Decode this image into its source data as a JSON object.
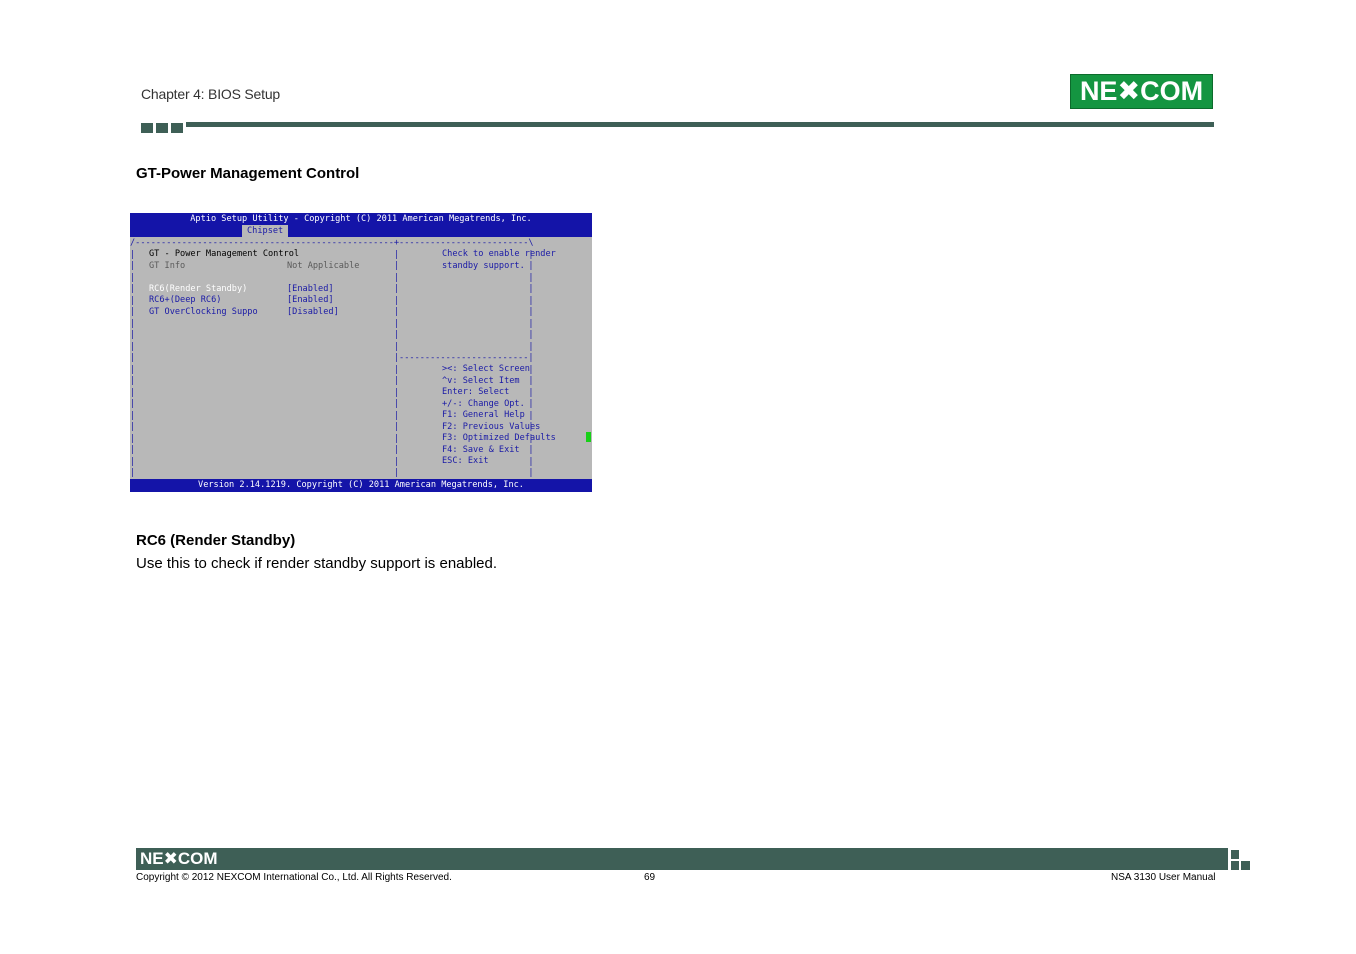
{
  "header": {
    "chapter": "Chapter 4: BIOS Setup",
    "logo": "NE✖COM",
    "brand_color": "#149541",
    "rule_color": "#3e5f56"
  },
  "section": {
    "heading": "GT-Power Management Control"
  },
  "bios": {
    "title": "Aptio Setup Utility - Copyright (C) 2011 American Megatrends, Inc.",
    "tab": "Chipset",
    "menu": [
      {
        "label": "GT - Power Management Control",
        "value": ""
      },
      {
        "label": "GT Info",
        "value": "Not Applicable"
      },
      {
        "label": "RC6(Render Standby)",
        "value": "[Enabled]"
      },
      {
        "label": "RC6+(Deep RC6)",
        "value": "[Enabled]"
      },
      {
        "label": "GT OverClocking Suppo",
        "value": "[Disabled]"
      }
    ],
    "help": [
      "Check to enable render",
      "standby support."
    ],
    "keys": [
      "><: Select Screen",
      "^v: Select Item",
      "Enter: Select",
      "+/-: Change Opt.",
      "F1: General Help",
      "F2: Previous Values",
      "F3: Optimized Defaults",
      "F4: Save & Exit",
      "ESC: Exit"
    ],
    "footer": "Version 2.14.1219. Copyright (C) 2011 American Megatrends, Inc."
  },
  "item": {
    "heading": "RC6 (Render Standby)",
    "description": "Use this to check if render standby support is enabled."
  },
  "footer": {
    "logo": "NE✖COM",
    "copyright": "Copyright © 2012 NEXCOM International Co., Ltd. All Rights Reserved.",
    "page": "69",
    "manual": "NSA 3130 User Manual"
  }
}
